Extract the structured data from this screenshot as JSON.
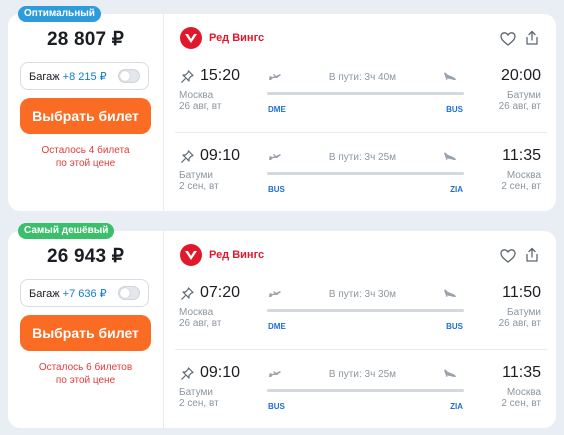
{
  "currency": "₽",
  "colors": {
    "badge_optimal": "#2d9cdb",
    "badge_cheapest": "#3bbf6b",
    "buy_button": "#fa6b23",
    "warning_text": "#e23b3b",
    "airline_red": "#e1182b",
    "airport_code": "#1e6fd1"
  },
  "offers": [
    {
      "badge": "Оптимальный",
      "price": "28 807 ₽",
      "baggage_label": "Багаж",
      "baggage_price": "+8 215 ₽",
      "baggage_enabled": false,
      "buy_label": "Выбрать билет",
      "seats_left_line1": "Осталось 4 билета",
      "seats_left_line2": "по этой цене",
      "airline": "Ред Вингс",
      "icons": {
        "favorite": "heart-icon",
        "share": "share-icon",
        "pin": "pin-icon",
        "takeoff": "takeoff-icon",
        "landing": "landing-icon"
      },
      "segments": [
        {
          "dep_time": "15:20",
          "dep_city": "Москва",
          "dep_date": "26 авг, вт",
          "arr_time": "20:00",
          "arr_city": "Батуми",
          "arr_date": "26 авг, вт",
          "duration": "В пути: 3ч 40м",
          "from_code": "DME",
          "to_code": "BUS"
        },
        {
          "dep_time": "09:10",
          "dep_city": "Батуми",
          "dep_date": "2 сен, вт",
          "arr_time": "11:35",
          "arr_city": "Москва",
          "arr_date": "2 сен, вт",
          "duration": "В пути: 3ч 25м",
          "from_code": "BUS",
          "to_code": "ZIA"
        }
      ]
    },
    {
      "badge": "Самый дешёвый",
      "price": "26 943 ₽",
      "baggage_label": "Багаж",
      "baggage_price": "+7 636 ₽",
      "baggage_enabled": false,
      "buy_label": "Выбрать билет",
      "seats_left_line1": "Осталось 6 билетов",
      "seats_left_line2": "по этой цене",
      "airline": "Ред Вингс",
      "icons": {
        "favorite": "heart-icon",
        "share": "share-icon",
        "pin": "pin-icon",
        "takeoff": "takeoff-icon",
        "landing": "landing-icon"
      },
      "segments": [
        {
          "dep_time": "07:20",
          "dep_city": "Москва",
          "dep_date": "26 авг, вт",
          "arr_time": "11:50",
          "arr_city": "Батуми",
          "arr_date": "26 авг, вт",
          "duration": "В пути: 3ч 30м",
          "from_code": "DME",
          "to_code": "BUS"
        },
        {
          "dep_time": "09:10",
          "dep_city": "Батуми",
          "dep_date": "2 сен, вт",
          "arr_time": "11:35",
          "arr_city": "Москва",
          "arr_date": "2 сен, вт",
          "duration": "В пути: 3ч 25м",
          "from_code": "BUS",
          "to_code": "ZIA"
        }
      ]
    }
  ]
}
